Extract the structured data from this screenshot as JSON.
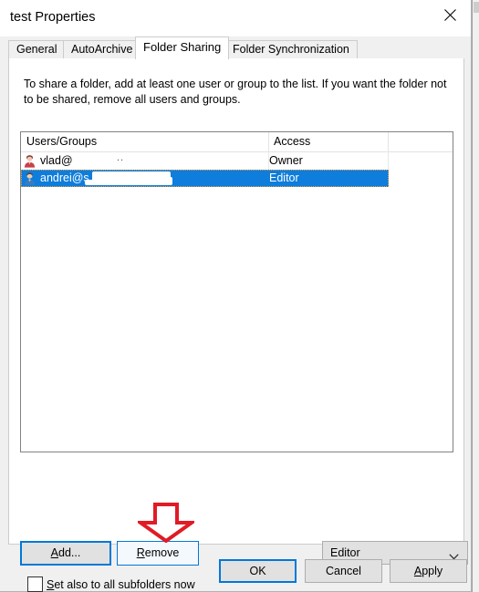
{
  "window": {
    "title": "test Properties",
    "close_icon": "close-icon"
  },
  "tabs": [
    {
      "label": "General",
      "active": false
    },
    {
      "label": "AutoArchive",
      "active": false
    },
    {
      "label": "Folder Sharing",
      "active": true
    },
    {
      "label": "Folder Synchronization",
      "active": false
    }
  ],
  "panel": {
    "description": "To share a folder, add at least one user or group to the list. If you want the folder not to be shared, remove all users and groups."
  },
  "list": {
    "columns": [
      "Users/Groups",
      "Access"
    ],
    "rows": [
      {
        "user": "vlad@",
        "access": "Owner",
        "avatar_icon": "user-avatar-icon",
        "avatar_color": "#c8414b",
        "selected": false,
        "redacted": true
      },
      {
        "user": "andrei@s",
        "access": "Editor",
        "avatar_icon": "user-avatar-icon",
        "avatar_color": "#3a7bbf",
        "selected": true,
        "redacted": true
      }
    ]
  },
  "controls": {
    "add_label": "Add...",
    "add_accesskey": "A",
    "remove_label": "Remove",
    "remove_accesskey": "R",
    "access_select_value": "Editor",
    "access_select_options": [
      "Editor"
    ],
    "chevron_icon": "chevron-down-icon",
    "subfolders_label": "Set also to all subfolders now",
    "subfolders_accesskey": "S",
    "subfolders_checked": false
  },
  "footer": {
    "ok_label": "OK",
    "cancel_label": "Cancel",
    "apply_label": "Apply",
    "apply_accesskey": "A"
  },
  "annotation": {
    "arrow_icon": "down-arrow-annotation-icon",
    "color": "#e01b24",
    "points_at": "remove-button"
  }
}
